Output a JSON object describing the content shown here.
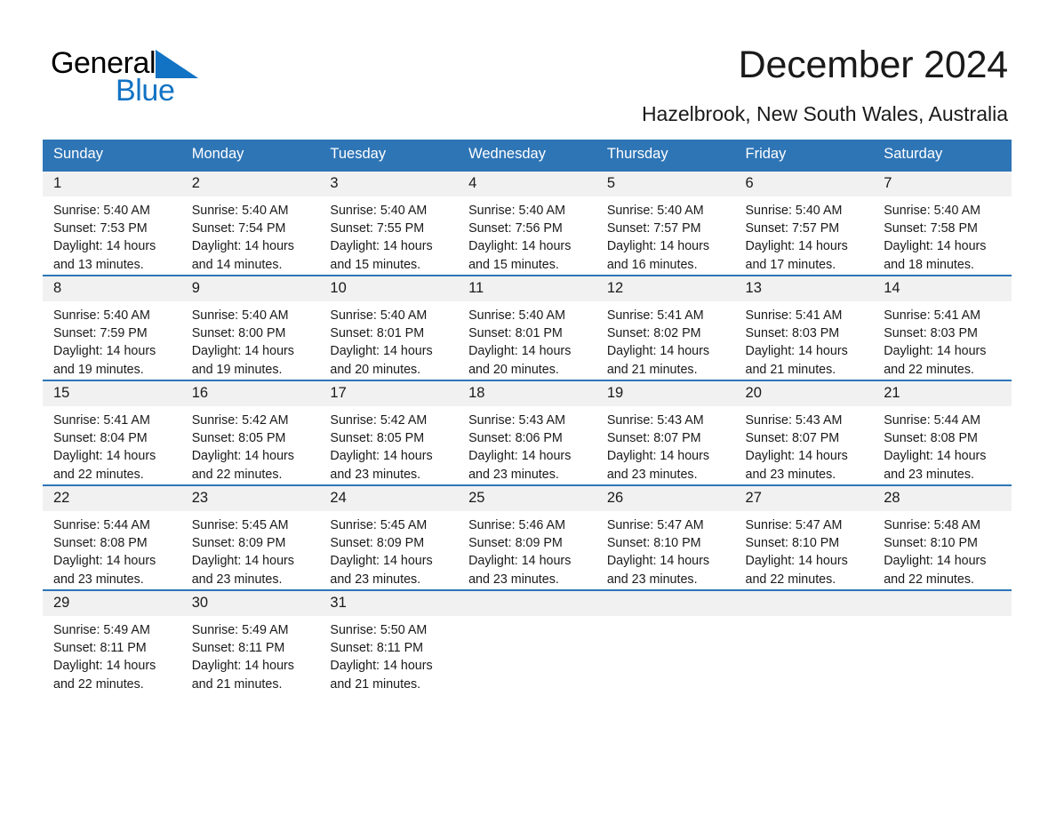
{
  "brand": {
    "name_part1": "General",
    "name_part2": "Blue",
    "logo_icon": "blue-triangle-icon",
    "color_black": "#000000",
    "color_blue": "#1273c4"
  },
  "header": {
    "title": "December 2024",
    "subtitle": "Hazelbrook, New South Wales, Australia"
  },
  "theme": {
    "header_blue": "#2e75b6",
    "daynum_band": "#f1f1f1",
    "text": "#1a1a1a"
  },
  "calendar": {
    "weekday_headers": [
      "Sunday",
      "Monday",
      "Tuesday",
      "Wednesday",
      "Thursday",
      "Friday",
      "Saturday"
    ],
    "weeks": [
      [
        {
          "day": "1",
          "sunrise": "Sunrise: 5:40 AM",
          "sunset": "Sunset: 7:53 PM",
          "daylight_line1": "Daylight: 14 hours",
          "daylight_line2": "and 13 minutes."
        },
        {
          "day": "2",
          "sunrise": "Sunrise: 5:40 AM",
          "sunset": "Sunset: 7:54 PM",
          "daylight_line1": "Daylight: 14 hours",
          "daylight_line2": "and 14 minutes."
        },
        {
          "day": "3",
          "sunrise": "Sunrise: 5:40 AM",
          "sunset": "Sunset: 7:55 PM",
          "daylight_line1": "Daylight: 14 hours",
          "daylight_line2": "and 15 minutes."
        },
        {
          "day": "4",
          "sunrise": "Sunrise: 5:40 AM",
          "sunset": "Sunset: 7:56 PM",
          "daylight_line1": "Daylight: 14 hours",
          "daylight_line2": "and 15 minutes."
        },
        {
          "day": "5",
          "sunrise": "Sunrise: 5:40 AM",
          "sunset": "Sunset: 7:57 PM",
          "daylight_line1": "Daylight: 14 hours",
          "daylight_line2": "and 16 minutes."
        },
        {
          "day": "6",
          "sunrise": "Sunrise: 5:40 AM",
          "sunset": "Sunset: 7:57 PM",
          "daylight_line1": "Daylight: 14 hours",
          "daylight_line2": "and 17 minutes."
        },
        {
          "day": "7",
          "sunrise": "Sunrise: 5:40 AM",
          "sunset": "Sunset: 7:58 PM",
          "daylight_line1": "Daylight: 14 hours",
          "daylight_line2": "and 18 minutes."
        }
      ],
      [
        {
          "day": "8",
          "sunrise": "Sunrise: 5:40 AM",
          "sunset": "Sunset: 7:59 PM",
          "daylight_line1": "Daylight: 14 hours",
          "daylight_line2": "and 19 minutes."
        },
        {
          "day": "9",
          "sunrise": "Sunrise: 5:40 AM",
          "sunset": "Sunset: 8:00 PM",
          "daylight_line1": "Daylight: 14 hours",
          "daylight_line2": "and 19 minutes."
        },
        {
          "day": "10",
          "sunrise": "Sunrise: 5:40 AM",
          "sunset": "Sunset: 8:01 PM",
          "daylight_line1": "Daylight: 14 hours",
          "daylight_line2": "and 20 minutes."
        },
        {
          "day": "11",
          "sunrise": "Sunrise: 5:40 AM",
          "sunset": "Sunset: 8:01 PM",
          "daylight_line1": "Daylight: 14 hours",
          "daylight_line2": "and 20 minutes."
        },
        {
          "day": "12",
          "sunrise": "Sunrise: 5:41 AM",
          "sunset": "Sunset: 8:02 PM",
          "daylight_line1": "Daylight: 14 hours",
          "daylight_line2": "and 21 minutes."
        },
        {
          "day": "13",
          "sunrise": "Sunrise: 5:41 AM",
          "sunset": "Sunset: 8:03 PM",
          "daylight_line1": "Daylight: 14 hours",
          "daylight_line2": "and 21 minutes."
        },
        {
          "day": "14",
          "sunrise": "Sunrise: 5:41 AM",
          "sunset": "Sunset: 8:03 PM",
          "daylight_line1": "Daylight: 14 hours",
          "daylight_line2": "and 22 minutes."
        }
      ],
      [
        {
          "day": "15",
          "sunrise": "Sunrise: 5:41 AM",
          "sunset": "Sunset: 8:04 PM",
          "daylight_line1": "Daylight: 14 hours",
          "daylight_line2": "and 22 minutes."
        },
        {
          "day": "16",
          "sunrise": "Sunrise: 5:42 AM",
          "sunset": "Sunset: 8:05 PM",
          "daylight_line1": "Daylight: 14 hours",
          "daylight_line2": "and 22 minutes."
        },
        {
          "day": "17",
          "sunrise": "Sunrise: 5:42 AM",
          "sunset": "Sunset: 8:05 PM",
          "daylight_line1": "Daylight: 14 hours",
          "daylight_line2": "and 23 minutes."
        },
        {
          "day": "18",
          "sunrise": "Sunrise: 5:43 AM",
          "sunset": "Sunset: 8:06 PM",
          "daylight_line1": "Daylight: 14 hours",
          "daylight_line2": "and 23 minutes."
        },
        {
          "day": "19",
          "sunrise": "Sunrise: 5:43 AM",
          "sunset": "Sunset: 8:07 PM",
          "daylight_line1": "Daylight: 14 hours",
          "daylight_line2": "and 23 minutes."
        },
        {
          "day": "20",
          "sunrise": "Sunrise: 5:43 AM",
          "sunset": "Sunset: 8:07 PM",
          "daylight_line1": "Daylight: 14 hours",
          "daylight_line2": "and 23 minutes."
        },
        {
          "day": "21",
          "sunrise": "Sunrise: 5:44 AM",
          "sunset": "Sunset: 8:08 PM",
          "daylight_line1": "Daylight: 14 hours",
          "daylight_line2": "and 23 minutes."
        }
      ],
      [
        {
          "day": "22",
          "sunrise": "Sunrise: 5:44 AM",
          "sunset": "Sunset: 8:08 PM",
          "daylight_line1": "Daylight: 14 hours",
          "daylight_line2": "and 23 minutes."
        },
        {
          "day": "23",
          "sunrise": "Sunrise: 5:45 AM",
          "sunset": "Sunset: 8:09 PM",
          "daylight_line1": "Daylight: 14 hours",
          "daylight_line2": "and 23 minutes."
        },
        {
          "day": "24",
          "sunrise": "Sunrise: 5:45 AM",
          "sunset": "Sunset: 8:09 PM",
          "daylight_line1": "Daylight: 14 hours",
          "daylight_line2": "and 23 minutes."
        },
        {
          "day": "25",
          "sunrise": "Sunrise: 5:46 AM",
          "sunset": "Sunset: 8:09 PM",
          "daylight_line1": "Daylight: 14 hours",
          "daylight_line2": "and 23 minutes."
        },
        {
          "day": "26",
          "sunrise": "Sunrise: 5:47 AM",
          "sunset": "Sunset: 8:10 PM",
          "daylight_line1": "Daylight: 14 hours",
          "daylight_line2": "and 23 minutes."
        },
        {
          "day": "27",
          "sunrise": "Sunrise: 5:47 AM",
          "sunset": "Sunset: 8:10 PM",
          "daylight_line1": "Daylight: 14 hours",
          "daylight_line2": "and 22 minutes."
        },
        {
          "day": "28",
          "sunrise": "Sunrise: 5:48 AM",
          "sunset": "Sunset: 8:10 PM",
          "daylight_line1": "Daylight: 14 hours",
          "daylight_line2": "and 22 minutes."
        }
      ],
      [
        {
          "day": "29",
          "sunrise": "Sunrise: 5:49 AM",
          "sunset": "Sunset: 8:11 PM",
          "daylight_line1": "Daylight: 14 hours",
          "daylight_line2": "and 22 minutes."
        },
        {
          "day": "30",
          "sunrise": "Sunrise: 5:49 AM",
          "sunset": "Sunset: 8:11 PM",
          "daylight_line1": "Daylight: 14 hours",
          "daylight_line2": "and 21 minutes."
        },
        {
          "day": "31",
          "sunrise": "Sunrise: 5:50 AM",
          "sunset": "Sunset: 8:11 PM",
          "daylight_line1": "Daylight: 14 hours",
          "daylight_line2": "and 21 minutes."
        },
        {
          "day": "",
          "sunrise": "",
          "sunset": "",
          "daylight_line1": "",
          "daylight_line2": ""
        },
        {
          "day": "",
          "sunrise": "",
          "sunset": "",
          "daylight_line1": "",
          "daylight_line2": ""
        },
        {
          "day": "",
          "sunrise": "",
          "sunset": "",
          "daylight_line1": "",
          "daylight_line2": ""
        },
        {
          "day": "",
          "sunrise": "",
          "sunset": "",
          "daylight_line1": "",
          "daylight_line2": ""
        }
      ]
    ]
  }
}
